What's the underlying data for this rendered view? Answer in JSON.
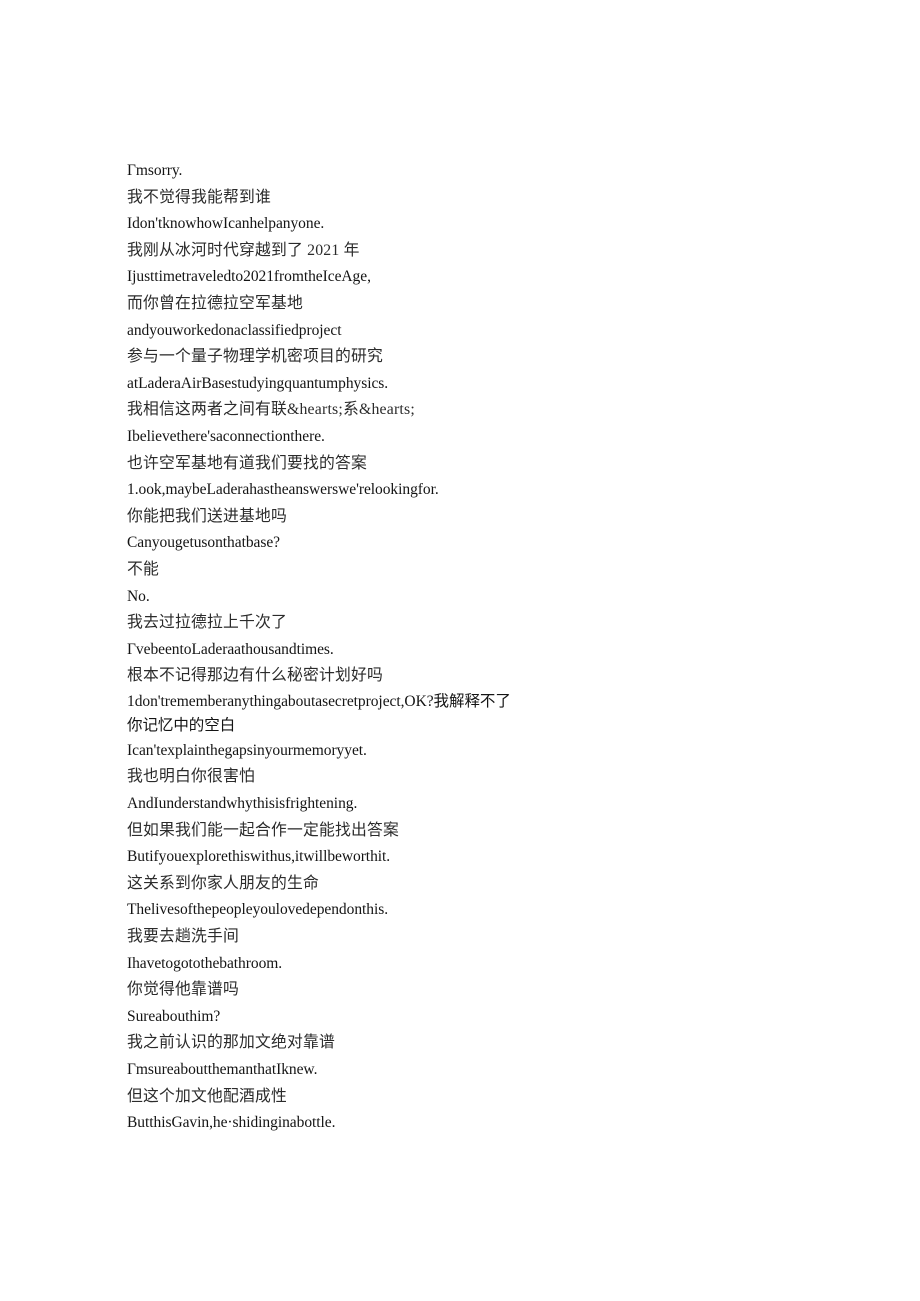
{
  "document": {
    "type": "bilingual-subtitle-transcript",
    "background_color": "#ffffff",
    "text_color": "#1a1a1a",
    "lines": [
      {
        "id": "l1",
        "lang": "en",
        "text": "Γmsorry."
      },
      {
        "id": "l2",
        "lang": "zh",
        "text": "我不觉得我能帮到谁"
      },
      {
        "id": "l3",
        "lang": "en",
        "text": "Idon'tknowhowIcanhelpanyone."
      },
      {
        "id": "l4",
        "lang": "zh",
        "text": "我刚从冰河时代穿越到了 2021 年"
      },
      {
        "id": "l5",
        "lang": "en",
        "text": "Ijusttimetraveledto2021fromtheIceAge,"
      },
      {
        "id": "l6",
        "lang": "zh",
        "text": "而你曾在拉德拉空军基地"
      },
      {
        "id": "l7",
        "lang": "en",
        "text": "andyouworkedonaclassifiedproject"
      },
      {
        "id": "l8",
        "lang": "zh",
        "text": "参与一个量子物理学机密项目的研究"
      },
      {
        "id": "l9",
        "lang": "en",
        "text": "atLaderaAirBasestudyingquantumphysics."
      },
      {
        "id": "l10",
        "lang": "zh",
        "text": "我相信这两者之间有联&hearts;系&hearts;"
      },
      {
        "id": "l11",
        "lang": "en",
        "text": "Ibelievethere'saconnectionthere."
      },
      {
        "id": "l12",
        "lang": "zh",
        "text": "也许空军基地有道我们要找的答案"
      },
      {
        "id": "l13",
        "lang": "en",
        "text": "1.ook,maybeLaderahastheanswerswe'relookingfor."
      },
      {
        "id": "l14",
        "lang": "zh",
        "text": "你能把我们送进基地吗"
      },
      {
        "id": "l15",
        "lang": "en",
        "text": "Canyougetusonthatbase?"
      },
      {
        "id": "l16",
        "lang": "zh",
        "text": "不能"
      },
      {
        "id": "l17",
        "lang": "en",
        "text": "No."
      },
      {
        "id": "l18",
        "lang": "zh",
        "text": "我去过拉德拉上千次了"
      },
      {
        "id": "l19",
        "lang": "en",
        "text": "ΓvebeentoLaderaathousandtimes."
      },
      {
        "id": "l20",
        "lang": "zh",
        "text": "根本不记得那边有什么秘密计划好吗"
      },
      {
        "id": "l21",
        "lang": "mixed",
        "wrapped": true,
        "text": "1don'trememberanythingaboutasecretproject,OK?我解释不了",
        "continuation": "你记忆中的空白"
      },
      {
        "id": "l22",
        "lang": "en",
        "text": "Ican'texplainthegapsinyourmemoryyet."
      },
      {
        "id": "l23",
        "lang": "zh",
        "text": "我也明白你很害怕"
      },
      {
        "id": "l24",
        "lang": "en",
        "text": "AndIunderstandwhythisisfrightening."
      },
      {
        "id": "l25",
        "lang": "zh",
        "text": "但如果我们能一起合作一定能找出答案"
      },
      {
        "id": "l26",
        "lang": "en",
        "text": "Butifyouexplorethiswithus,itwillbeworthit."
      },
      {
        "id": "l27",
        "lang": "zh",
        "text": "这关系到你家人朋友的生命"
      },
      {
        "id": "l28",
        "lang": "en",
        "text": "Thelivesofthepeopleyoulovedependonthis."
      },
      {
        "id": "l29",
        "lang": "zh",
        "text": "我要去趟洗手间"
      },
      {
        "id": "l30",
        "lang": "en",
        "text": "Ihavetogotothebathroom."
      },
      {
        "id": "l31",
        "lang": "zh",
        "text": "你觉得他靠谱吗"
      },
      {
        "id": "l32",
        "lang": "en",
        "text": "Sureabouthim?"
      },
      {
        "id": "l33",
        "lang": "zh",
        "text": "我之前认识的那加文绝对靠谱"
      },
      {
        "id": "l34",
        "lang": "en",
        "text": "ΓmsureaboutthemanthatIknew."
      },
      {
        "id": "l35",
        "lang": "zh",
        "text": "但这个加文他配酒成性"
      },
      {
        "id": "l36",
        "lang": "en",
        "text": "ButthisGavin,he·shidinginabottle."
      }
    ]
  }
}
